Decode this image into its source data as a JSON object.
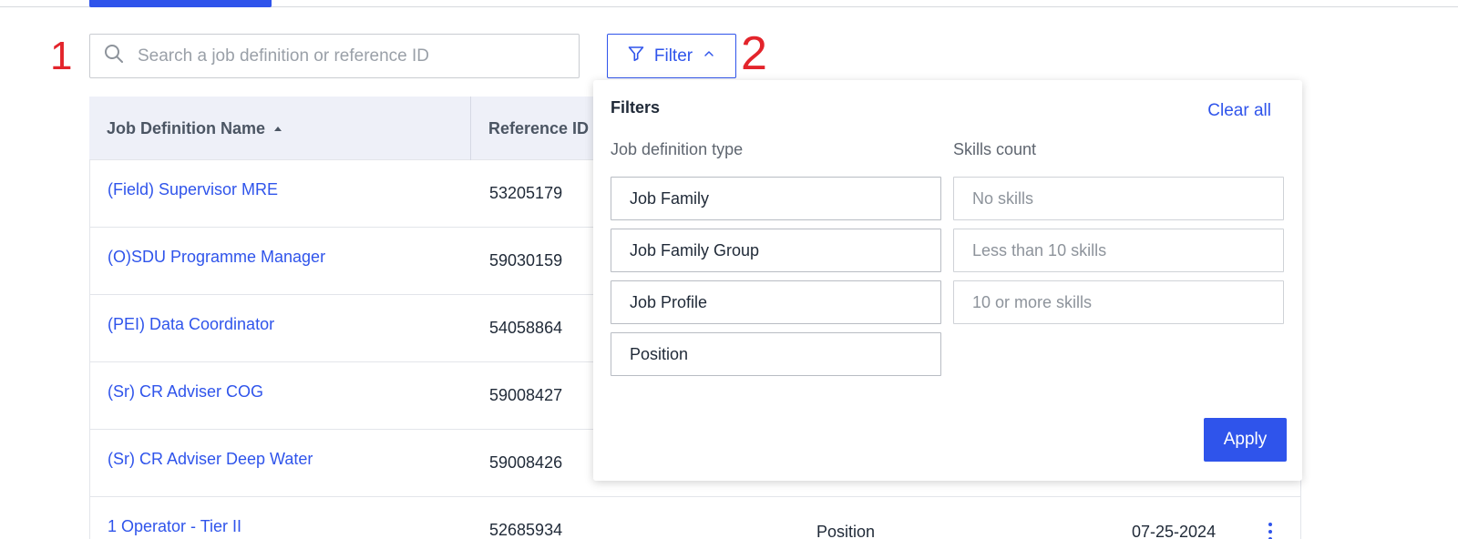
{
  "annotations": {
    "step1": "1",
    "step2": "2"
  },
  "search": {
    "placeholder": "Search a job definition or reference ID",
    "value": ""
  },
  "filter_button": {
    "label": "Filter"
  },
  "table": {
    "headers": {
      "name": "Job Definition Name",
      "reference_id": "Reference ID"
    },
    "rows": [
      {
        "name": "(Field) Supervisor MRE",
        "reference_id": "53205179",
        "type": "",
        "date": ""
      },
      {
        "name": "(O)SDU Programme Manager",
        "reference_id": "59030159",
        "type": "",
        "date": ""
      },
      {
        "name": "(PEI) Data Coordinator",
        "reference_id": "54058864",
        "type": "",
        "date": ""
      },
      {
        "name": "(Sr) CR Adviser COG",
        "reference_id": "59008427",
        "type": "",
        "date": ""
      },
      {
        "name": "(Sr) CR Adviser Deep Water",
        "reference_id": "59008426",
        "type": "",
        "date": ""
      },
      {
        "name": "1 Operator - Tier II",
        "reference_id": "52685934",
        "type": "Position",
        "date": "07-25-2024"
      }
    ]
  },
  "filters_panel": {
    "title": "Filters",
    "clear_all": "Clear all",
    "job_type_label": "Job definition type",
    "job_types": [
      "Job Family",
      "Job Family Group",
      "Job Profile",
      "Position"
    ],
    "skills_label": "Skills count",
    "skills_options": [
      "No skills",
      "Less than 10 skills",
      "10 or more skills"
    ],
    "apply": "Apply"
  },
  "colors": {
    "accent": "#2f54eb",
    "annotation": "#e3242b",
    "header_bg": "#eef0f8"
  },
  "icons": {
    "search": "search-icon",
    "filter": "funnel-icon",
    "chevron": "chevron-up-icon",
    "kebab": "kebab-menu-icon",
    "sort": "sort-ascending-icon"
  }
}
